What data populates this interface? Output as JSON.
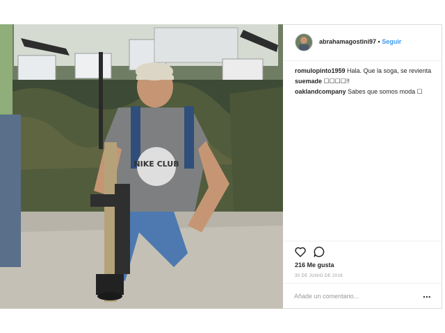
{
  "post": {
    "username": "abrahamagostini97",
    "separator": "•",
    "follow_label": "Seguir",
    "comments": [
      {
        "user": "romulopinto1959",
        "text": "Hala. Que la soga, se revienta"
      },
      {
        "user": "suemade",
        "text": "☐☐☐☐!!"
      },
      {
        "user": "oaklandcompany",
        "text": "Sabes que somos moda ☐"
      }
    ],
    "likes": "216 Me gusta",
    "date": "30 DE JUNIO DE 2016",
    "add_comment_placeholder": "Añade un comentario...",
    "more_label": "..."
  },
  "photo": {
    "shirt_text": "NIKE CLUB",
    "icons": {
      "like": "heart-icon",
      "comment": "comment-icon",
      "more": "more-options-icon"
    }
  },
  "colors": {
    "link": "#3897f0",
    "text": "#262626",
    "muted": "#999999",
    "border": "#efefef"
  }
}
